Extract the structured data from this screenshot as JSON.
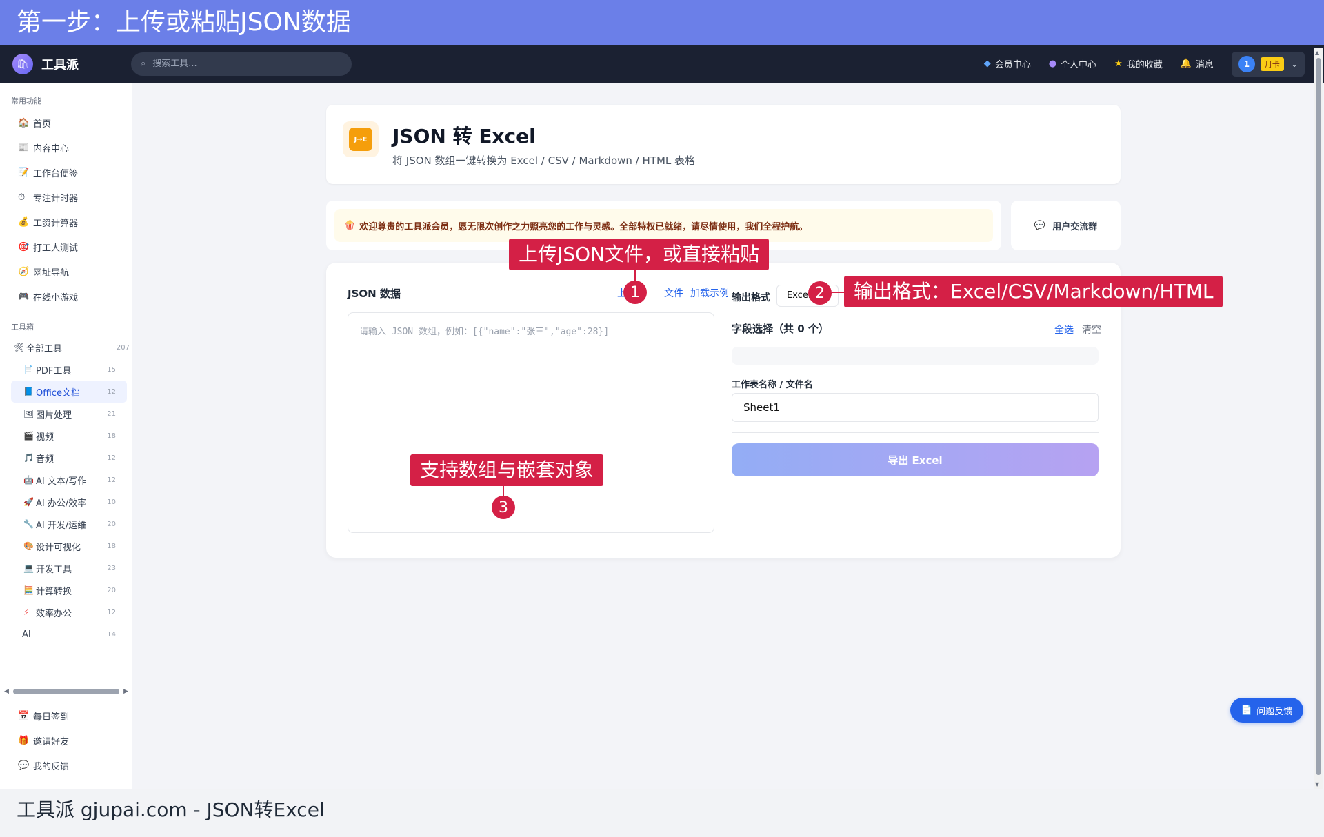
{
  "banner": "第一步：上传或粘贴JSON数据",
  "app": {
    "logo_icon": "bag-icon",
    "name": "工具派"
  },
  "search": {
    "placeholder": "搜索工具..."
  },
  "nav": {
    "items": [
      {
        "icon": "diamond-icon",
        "label": "会员中心"
      },
      {
        "icon": "person-icon",
        "label": "个人中心"
      },
      {
        "icon": "star-icon",
        "label": "我的收藏"
      },
      {
        "icon": "bell-icon",
        "label": "消息"
      }
    ],
    "user": {
      "avatar": "1",
      "badge": "月卡"
    }
  },
  "sidebar": {
    "common_title": "常用功能",
    "common": [
      {
        "icon": "house-icon",
        "label": "首页"
      },
      {
        "icon": "news-icon",
        "label": "内容中心"
      },
      {
        "icon": "memo-icon",
        "label": "工作台便签"
      },
      {
        "icon": "stopwatch-icon",
        "label": "专注计时器"
      },
      {
        "icon": "money-bag-icon",
        "label": "工资计算器"
      },
      {
        "icon": "target-icon",
        "label": "打工人测试"
      },
      {
        "icon": "compass-icon",
        "label": "网址导航"
      },
      {
        "icon": "gamepad-icon",
        "label": "在线小游戏"
      }
    ],
    "toolbox_title": "工具箱",
    "all_tools": {
      "icon": "tools-icon",
      "label": "全部工具",
      "count": "207"
    },
    "categories": [
      {
        "icon": "page-icon",
        "label": "PDF工具",
        "count": "15"
      },
      {
        "icon": "blue-book-icon",
        "label": "Office文档",
        "count": "12"
      },
      {
        "icon": "picture-icon",
        "label": "图片处理",
        "count": "21"
      },
      {
        "icon": "clapper-icon",
        "label": "视频",
        "count": "18"
      },
      {
        "icon": "music-icon",
        "label": "音频",
        "count": "12"
      },
      {
        "icon": "robot-icon",
        "label": "AI 文本/写作",
        "count": "12"
      },
      {
        "icon": "rocket-icon",
        "label": "AI 办公/效率",
        "count": "10"
      },
      {
        "icon": "wrench-icon",
        "label": "AI 开发/运维",
        "count": "20"
      },
      {
        "icon": "palette-icon",
        "label": "设计可视化",
        "count": "18"
      },
      {
        "icon": "computer-icon",
        "label": "开发工具",
        "count": "23"
      },
      {
        "icon": "abacus-icon",
        "label": "计算转换",
        "count": "20"
      },
      {
        "icon": "bolt-icon",
        "label": "效率办公",
        "count": "12"
      }
    ],
    "ai": {
      "label": "AI",
      "count": "14"
    },
    "bottom": [
      {
        "icon": "calendar-icon",
        "label": "每日签到"
      },
      {
        "icon": "gift-icon",
        "label": "邀请好友"
      },
      {
        "icon": "speech-icon",
        "label": "我的反馈"
      }
    ]
  },
  "tool": {
    "icon_text": "J→E",
    "title": "JSON 转 Excel",
    "subtitle": "将 JSON 数组一键转换为 Excel / CSV / Markdown / HTML 表格"
  },
  "notice": {
    "icon": "popcorn-icon",
    "text": "欢迎尊贵的工具派会员，愿无限次创作之力照亮您的工作与灵感。全部特权已就绪，请尽情使用，我们全程护航。"
  },
  "group_button": {
    "icon": "chat-icon",
    "label": "用户交流群"
  },
  "panel": {
    "json_label": "JSON 数据",
    "upload_a": "上传",
    "upload_b": "文件",
    "load_example": "加载示例",
    "json_placeholder": "请输入 JSON 数组，例如：[{\"name\":\"张三\",\"age\":28}]",
    "format_label": "输出格式",
    "format_value": "Excel",
    "fields_label": "字段选择（共 0 个）",
    "select_all": "全选",
    "clear": "清空",
    "sheet_label": "工作表名称 / 文件名",
    "sheet_value": "Sheet1",
    "export_label": "导出 Excel"
  },
  "callouts": {
    "c1": {
      "num": "1",
      "text": "上传JSON文件，或直接粘贴"
    },
    "c2": {
      "num": "2",
      "text": "输出格式：Excel/CSV/Markdown/HTML"
    },
    "c3": {
      "num": "3",
      "text": "支持数组与嵌套对象"
    }
  },
  "feedback": {
    "icon": "doc-icon",
    "label": "问题反馈"
  },
  "footer": "工具派 gjupai.com - JSON转Excel"
}
